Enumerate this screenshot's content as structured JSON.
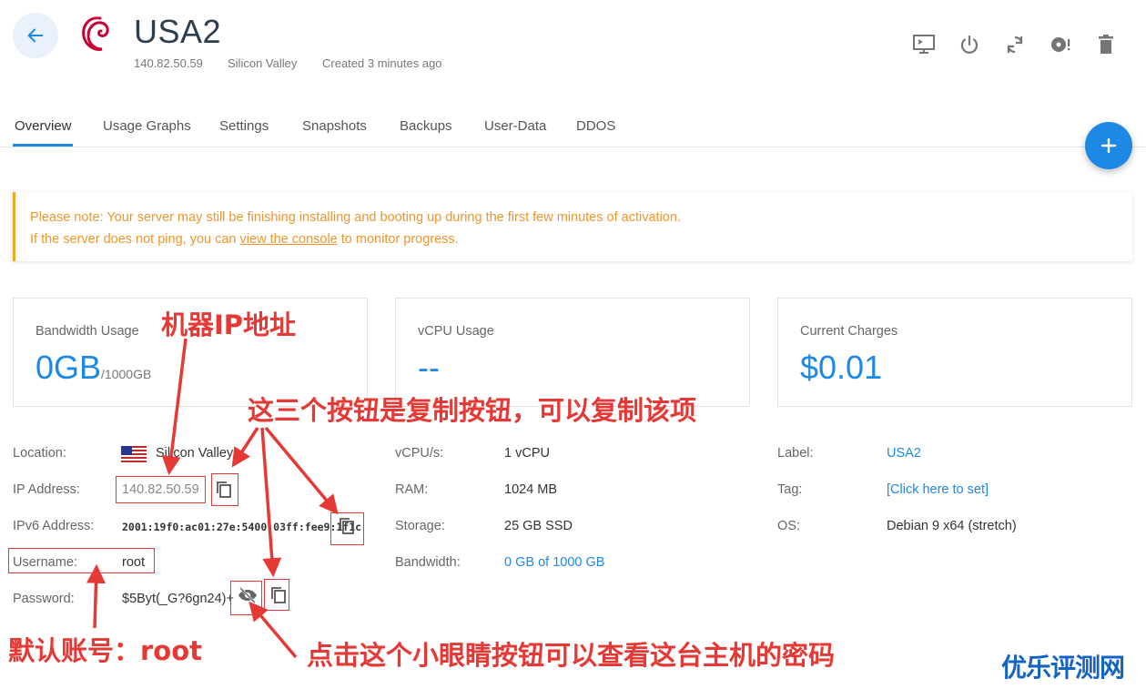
{
  "header": {
    "server_name": "USA2",
    "ip": "140.82.50.59",
    "location": "Silicon Valley",
    "created": "Created 3 minutes ago"
  },
  "tabs": [
    {
      "label": "Overview"
    },
    {
      "label": "Usage Graphs"
    },
    {
      "label": "Settings"
    },
    {
      "label": "Snapshots"
    },
    {
      "label": "Backups"
    },
    {
      "label": "User-Data"
    },
    {
      "label": "DDOS"
    }
  ],
  "notice": {
    "line1": "Please note: Your server may still be finishing installing and booting up during the first few minutes of activation.",
    "line2_prefix": "If the server does not ping, you can ",
    "line2_link": "view the console",
    "line2_suffix": " to monitor progress."
  },
  "cards": {
    "bandwidth": {
      "title": "Bandwidth Usage",
      "value": "0GB",
      "unit": "/1000GB"
    },
    "vcpu": {
      "title": "vCPU Usage",
      "value": "--"
    },
    "charges": {
      "title": "Current Charges",
      "value": "$0.01"
    }
  },
  "details": {
    "location_label": "Location:",
    "location_value": "Silicon Valley",
    "ip_label": "IP Address:",
    "ip_value": "140.82.50.59",
    "ipv6_label": "IPv6 Address:",
    "ipv6_value": "2001:19f0:ac01:27e:5400:03ff:fee9:1f1c",
    "username_label": "Username:",
    "username_value": "root",
    "password_label": "Password:",
    "password_value": "$5Byt(_G?6gn24)+",
    "vcpus_label": "vCPU/s:",
    "vcpus_value": "1 vCPU",
    "ram_label": "RAM:",
    "ram_value": "1024 MB",
    "storage_label": "Storage:",
    "storage_value": "25 GB SSD",
    "bandwidth_label": "Bandwidth:",
    "bandwidth_value": "0 GB of 1000 GB",
    "label_label": "Label:",
    "label_value": "USA2",
    "tag_label": "Tag:",
    "tag_value": "[Click here to set]",
    "os_label": "OS:",
    "os_value": "Debian 9 x64 (stretch)"
  },
  "annotations": {
    "ip_note": "机器IP地址",
    "copy_note": "这三个按钮是复制按钮，可以复制该项",
    "user_note": "默认账号：root",
    "eye_note": "点击这个小眼睛按钮可以查看这台主机的密码",
    "watermark": "优乐评测网"
  },
  "colors": {
    "accent": "#1e88e5",
    "notice": "#f0952a",
    "annotation": "#e53935",
    "watermark": "#1565c0"
  },
  "icons": [
    "arrow-left-icon",
    "debian-logo-icon",
    "console-icon",
    "power-icon",
    "restart-icon",
    "reinstall-icon",
    "trash-icon",
    "plus-icon",
    "us-flag-icon",
    "copy-icon",
    "eye-off-icon"
  ]
}
